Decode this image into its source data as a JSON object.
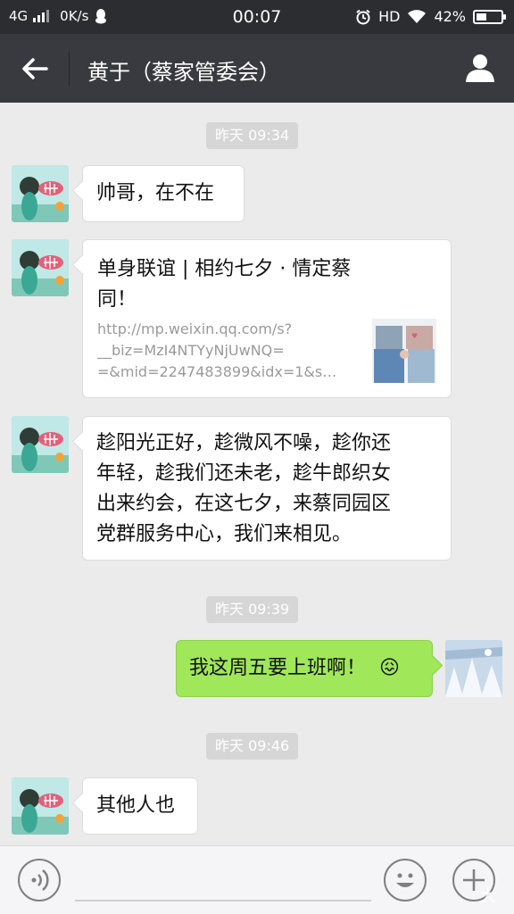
{
  "status_bar": {
    "network": "4G",
    "speed": "0K/s",
    "time": "00:07",
    "hd": "HD",
    "battery_percent": "42%",
    "battery_level": 0.42,
    "icons": [
      "signal-icon",
      "qq-icon",
      "alarm-icon",
      "wifi-icon",
      "battery-icon"
    ]
  },
  "header": {
    "title": "黄于（蔡家管委会）",
    "icons": [
      "back-arrow-icon",
      "profile-icon"
    ]
  },
  "messages": {
    "ts1": "昨天 09:34",
    "m1": "帅哥，在不在",
    "card": {
      "title_line1": "单身联谊 | 相约七夕 · 情定蔡",
      "title_line2": "同！",
      "desc_line1": "http://mp.weixin.qq.com/s?",
      "desc_line2": "__biz=MzI4NTYyNjUwNQ=",
      "desc_line3": "=&mid=2247483899&idx=1&s…"
    },
    "m3": {
      "line1": "趁阳光正好，趁微风不噪，趁你还",
      "line2": "年轻，趁我们还未老，趁牛郎织女",
      "line3": "出来约会，在这七夕，来蔡同园区",
      "line4": "党群服务中心，我们来相见。"
    },
    "ts2": "昨天 09:39",
    "m4": "我这周五要上班啊！",
    "m4_emoji": "😖",
    "ts3": "昨天 09:46",
    "m5": "其他人也"
  },
  "input_bar": {
    "icons": [
      "voice-icon",
      "emoji-icon",
      "plus-icon"
    ],
    "watermark": "大"
  },
  "colors": {
    "statusbar": "#2b2d30",
    "titlebar": "#393a3f",
    "chat_bg": "#ebebeb",
    "sent_bubble": "#a0e75a"
  }
}
